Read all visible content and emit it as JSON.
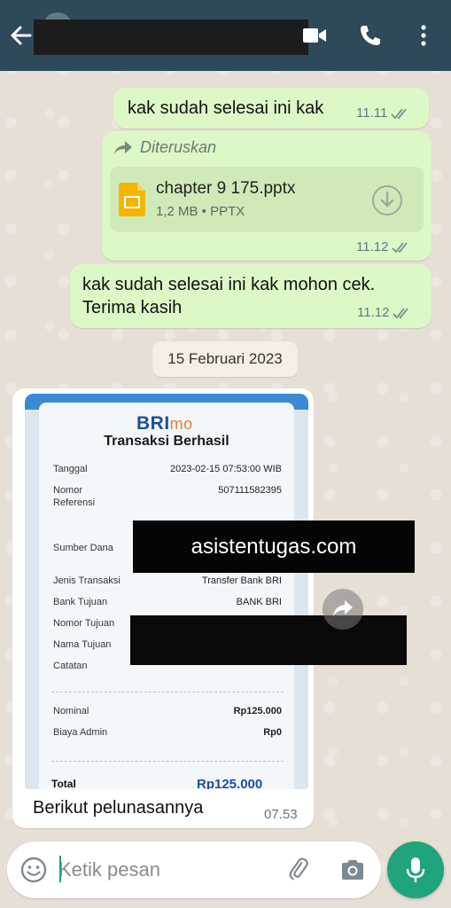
{
  "header": {
    "contact_name": "",
    "redacted": true
  },
  "messages": [
    {
      "id": 1,
      "text": "kak sudah selesai ini kak",
      "time": "11.11",
      "status": "read"
    },
    {
      "id": 2,
      "forwarded_label": "Diteruskan",
      "file_name": "chapter 9 175.pptx",
      "file_meta": "1,2 MB • PPTX",
      "time": "11.12",
      "status": "read"
    },
    {
      "id": 3,
      "text_line1": "kak sudah selesai ini kak mohon cek.",
      "text_line2": "Terima kasih",
      "time": "11.12",
      "status": "read"
    }
  ],
  "date_divider": "15 Februari 2023",
  "image_message": {
    "caption": "Berikut pelunasannya",
    "time": "07.53",
    "receipt": {
      "brand": "BRI",
      "brand_suffix": "mo",
      "title": "Transaksi Berhasil",
      "rows": [
        {
          "label": "Tanggal",
          "value": "2023-02-15 07:53:00 WIB"
        },
        {
          "label": "Nomor\nReferensi",
          "value": "507111582395"
        },
        {
          "label": "Sumber Dana",
          "value": ""
        },
        {
          "label": "Jenis Transaksi",
          "value": "Transfer Bank BRI"
        },
        {
          "label": "Bank Tujuan",
          "value": "BANK BRI"
        },
        {
          "label": "Nomor Tujuan",
          "value": ""
        },
        {
          "label": "Nama Tujuan",
          "value": ""
        },
        {
          "label": "Catatan",
          "value": ""
        },
        {
          "label": "Nominal",
          "value": "Rp125.000"
        },
        {
          "label": "Biaya Admin",
          "value": "Rp0"
        }
      ],
      "total_label": "Total",
      "total_value": "Rp125.000"
    },
    "watermark": "asistentugas.com"
  },
  "composer": {
    "placeholder": "Ketik pesan"
  },
  "colors": {
    "header": "#2e4a5a",
    "outgoing_bubble": "#dcf8c6",
    "mic_button": "#1fa47d",
    "bri_blue": "#1c4fa0"
  },
  "icons": [
    "back-arrow-icon",
    "video-call-icon",
    "phone-icon",
    "more-vert-icon",
    "forward-icon",
    "slides-file-icon",
    "download-icon",
    "double-check-icon",
    "share-icon",
    "emoji-icon",
    "attach-icon",
    "camera-icon",
    "mic-icon"
  ]
}
